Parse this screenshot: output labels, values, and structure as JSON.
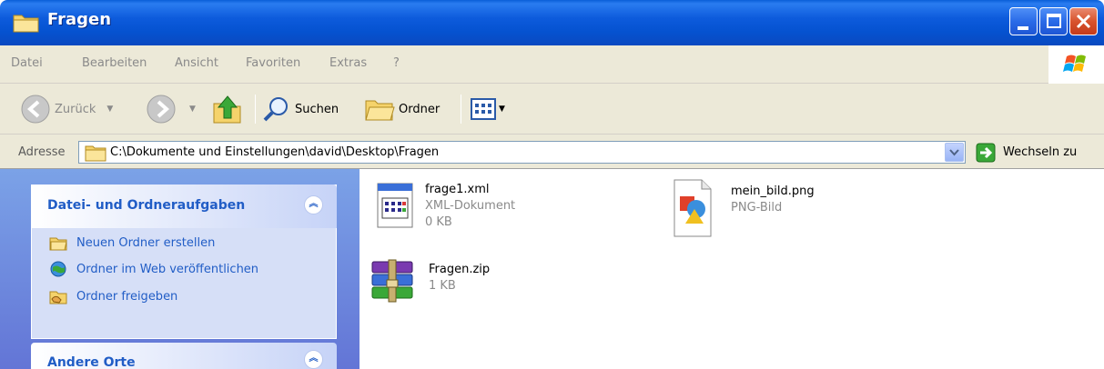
{
  "window": {
    "title": "Fragen"
  },
  "menu": [
    "Datei",
    "Bearbeiten",
    "Ansicht",
    "Favoriten",
    "Extras",
    "?"
  ],
  "toolbar": {
    "back_label": "Zurück",
    "search_label": "Suchen",
    "folders_label": "Ordner"
  },
  "address": {
    "label": "Adresse",
    "path": "C:\\Dokumente und Einstellungen\\david\\Desktop\\Fragen",
    "go_label": "Wechseln zu"
  },
  "taskpane": {
    "file_tasks_title": "Datei- und Ordneraufgaben",
    "tasks": [
      {
        "label": "Neuen Ordner erstellen",
        "icon": "new-folder-icon"
      },
      {
        "label": "Ordner im Web veröffentlichen",
        "icon": "web-publish-icon"
      },
      {
        "label": "Ordner freigeben",
        "icon": "share-folder-icon"
      }
    ],
    "other_places_title": "Andere Orte"
  },
  "files": [
    {
      "name": "frage1.xml",
      "type": "XML-Dokument",
      "size": "0 KB",
      "icon": "xml-file-icon"
    },
    {
      "name": "mein_bild.png",
      "type": "PNG-Bild",
      "size": "",
      "icon": "png-file-icon"
    },
    {
      "name": "Fragen.zip",
      "type": "",
      "size": "1 KB",
      "icon": "zip-archive-icon"
    }
  ],
  "colors": {
    "title_bar": "#0552d0",
    "task_link": "#215dc6",
    "chrome": "#ece9d8"
  }
}
